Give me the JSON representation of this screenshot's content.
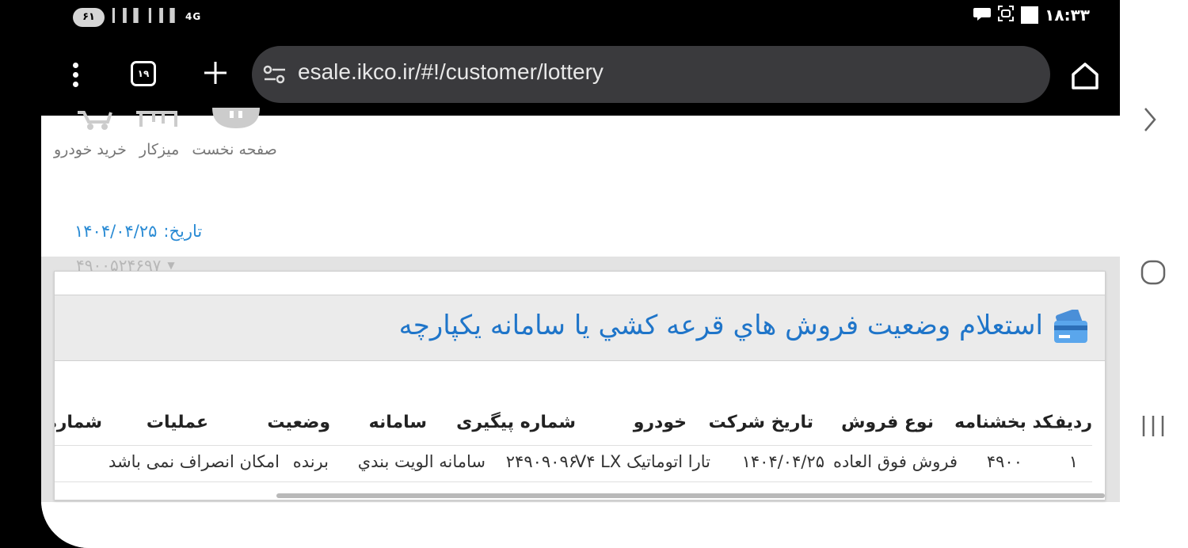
{
  "status_bar": {
    "battery": "۶۱",
    "network": "4G",
    "time": "۱۸:۳۳"
  },
  "toolbar": {
    "tab_count": "۱۹",
    "url": "esale.ikco.ir/#!/customer/lottery"
  },
  "nav": {
    "links": [
      "صفحه نخست",
      "ميزكار",
      "خريد خودرو"
    ]
  },
  "date": {
    "label": "تاريخ:",
    "value": "۱۴۰۴/۰۴/۲۵"
  },
  "user_id": "۴۹۰۰۵۲۴۶۹۷",
  "card": {
    "title": "استعلام وضعيت فروش هاي قرعه كشي يا سامانه يكپارچه"
  },
  "table": {
    "headers": [
      "رديف",
      "كد بخشنامه",
      "نوع فروش",
      "تاريخ شركت",
      "خودرو",
      "شماره پيگيری",
      "سامانه",
      "وضعيت",
      "عمليات",
      "شماره"
    ],
    "rows": [
      [
        "۱",
        "۴۹۰۰",
        "فروش فوق العاده",
        "۱۴۰۴/۰۴/۲۵",
        "تارا اتوماتيک V۴ LX",
        "۲۴۹۰۹۰۹۶",
        "سامانه الويت بندي",
        "برنده",
        "امكان انصراف نمی باشد",
        ""
      ]
    ]
  }
}
